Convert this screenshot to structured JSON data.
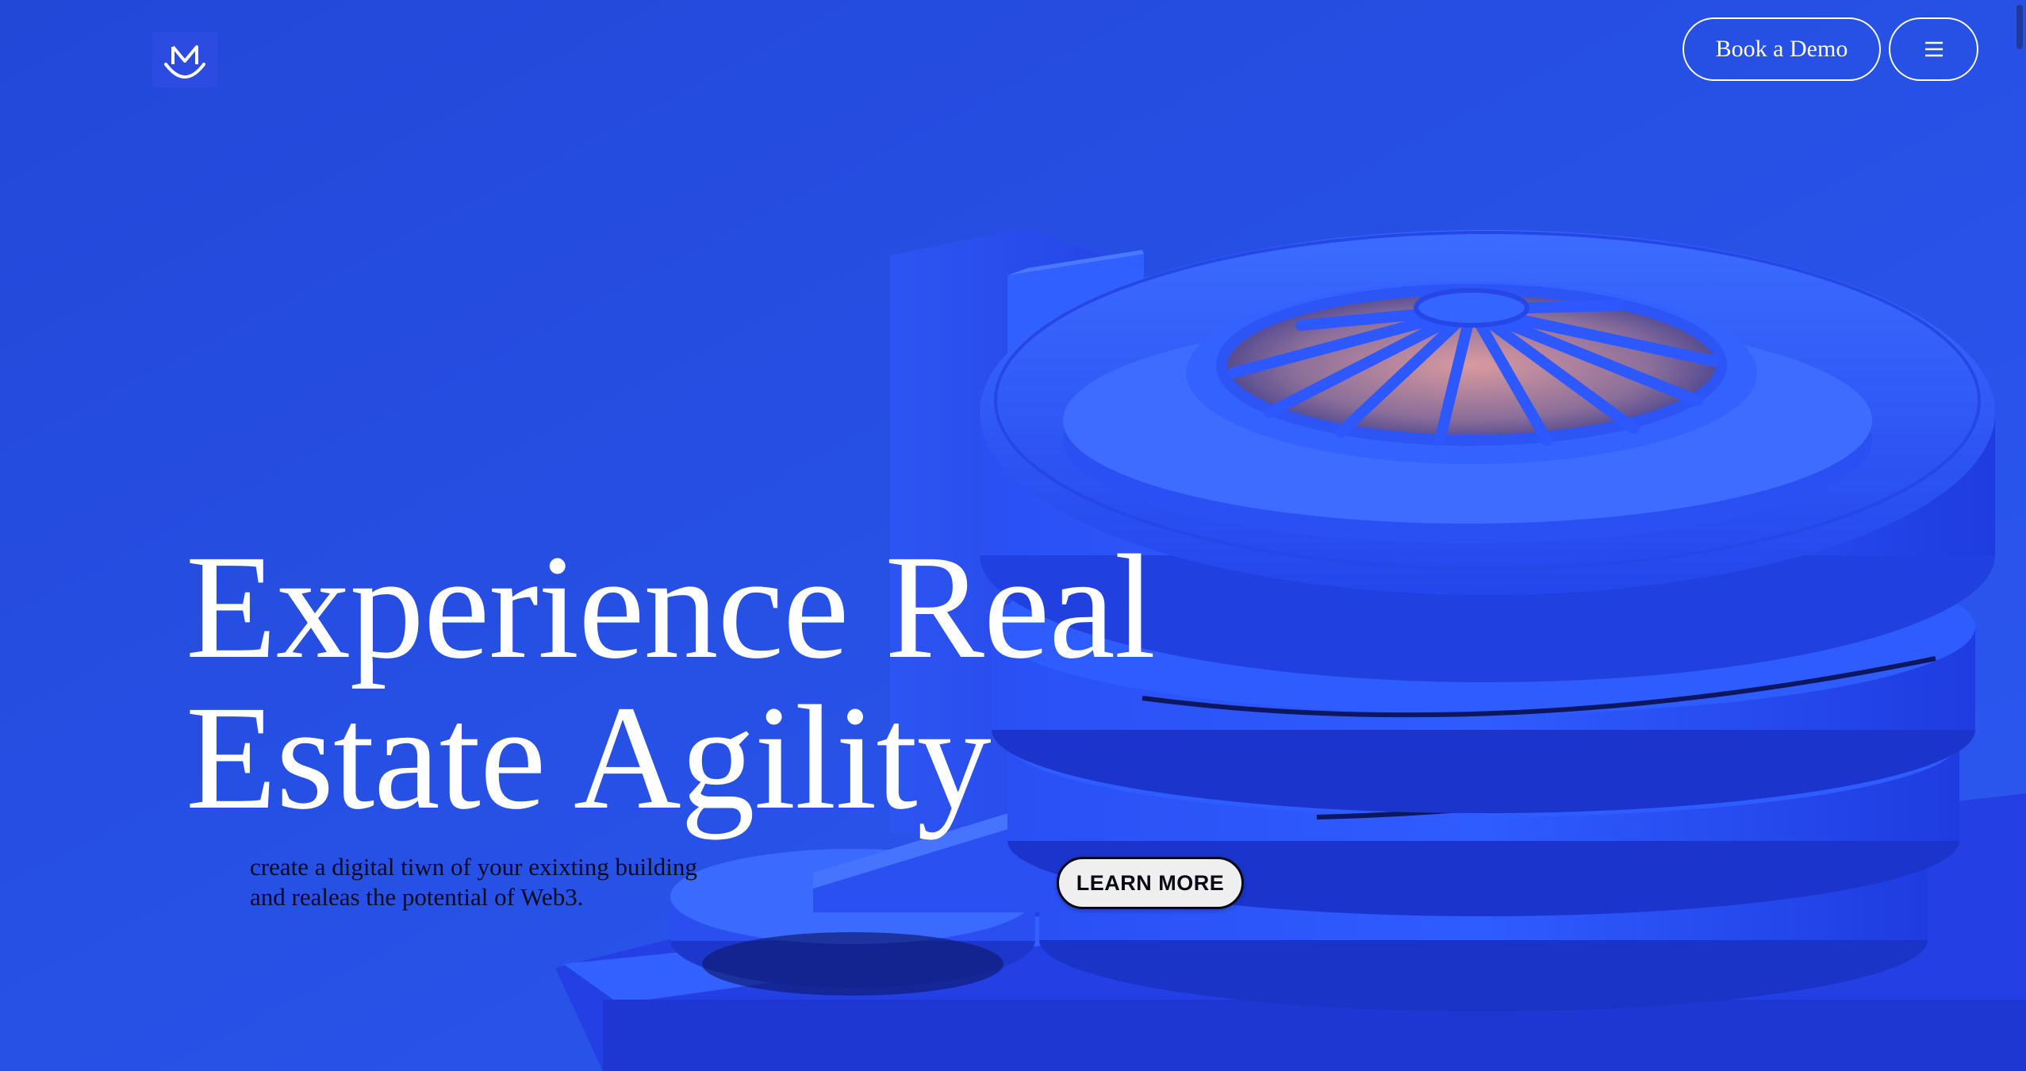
{
  "header": {
    "logo_icon": "m-crown-logo-icon",
    "book_demo_label": "Book a Demo",
    "menu_icon": "hamburger-menu-icon"
  },
  "hero": {
    "headline_line1": "Experience Real",
    "headline_line2": "Estate Agility",
    "subtitle_line1": "create a digital tiwn of your exixting building",
    "subtitle_line2": "and realeas the potential of Web3.",
    "cta_label": "LEARN MORE"
  },
  "colors": {
    "background": "#2449df",
    "building": "#2f5cff",
    "text_light": "#ffffff",
    "text_dark": "#0b0b1e",
    "cta_background": "#efefef"
  }
}
